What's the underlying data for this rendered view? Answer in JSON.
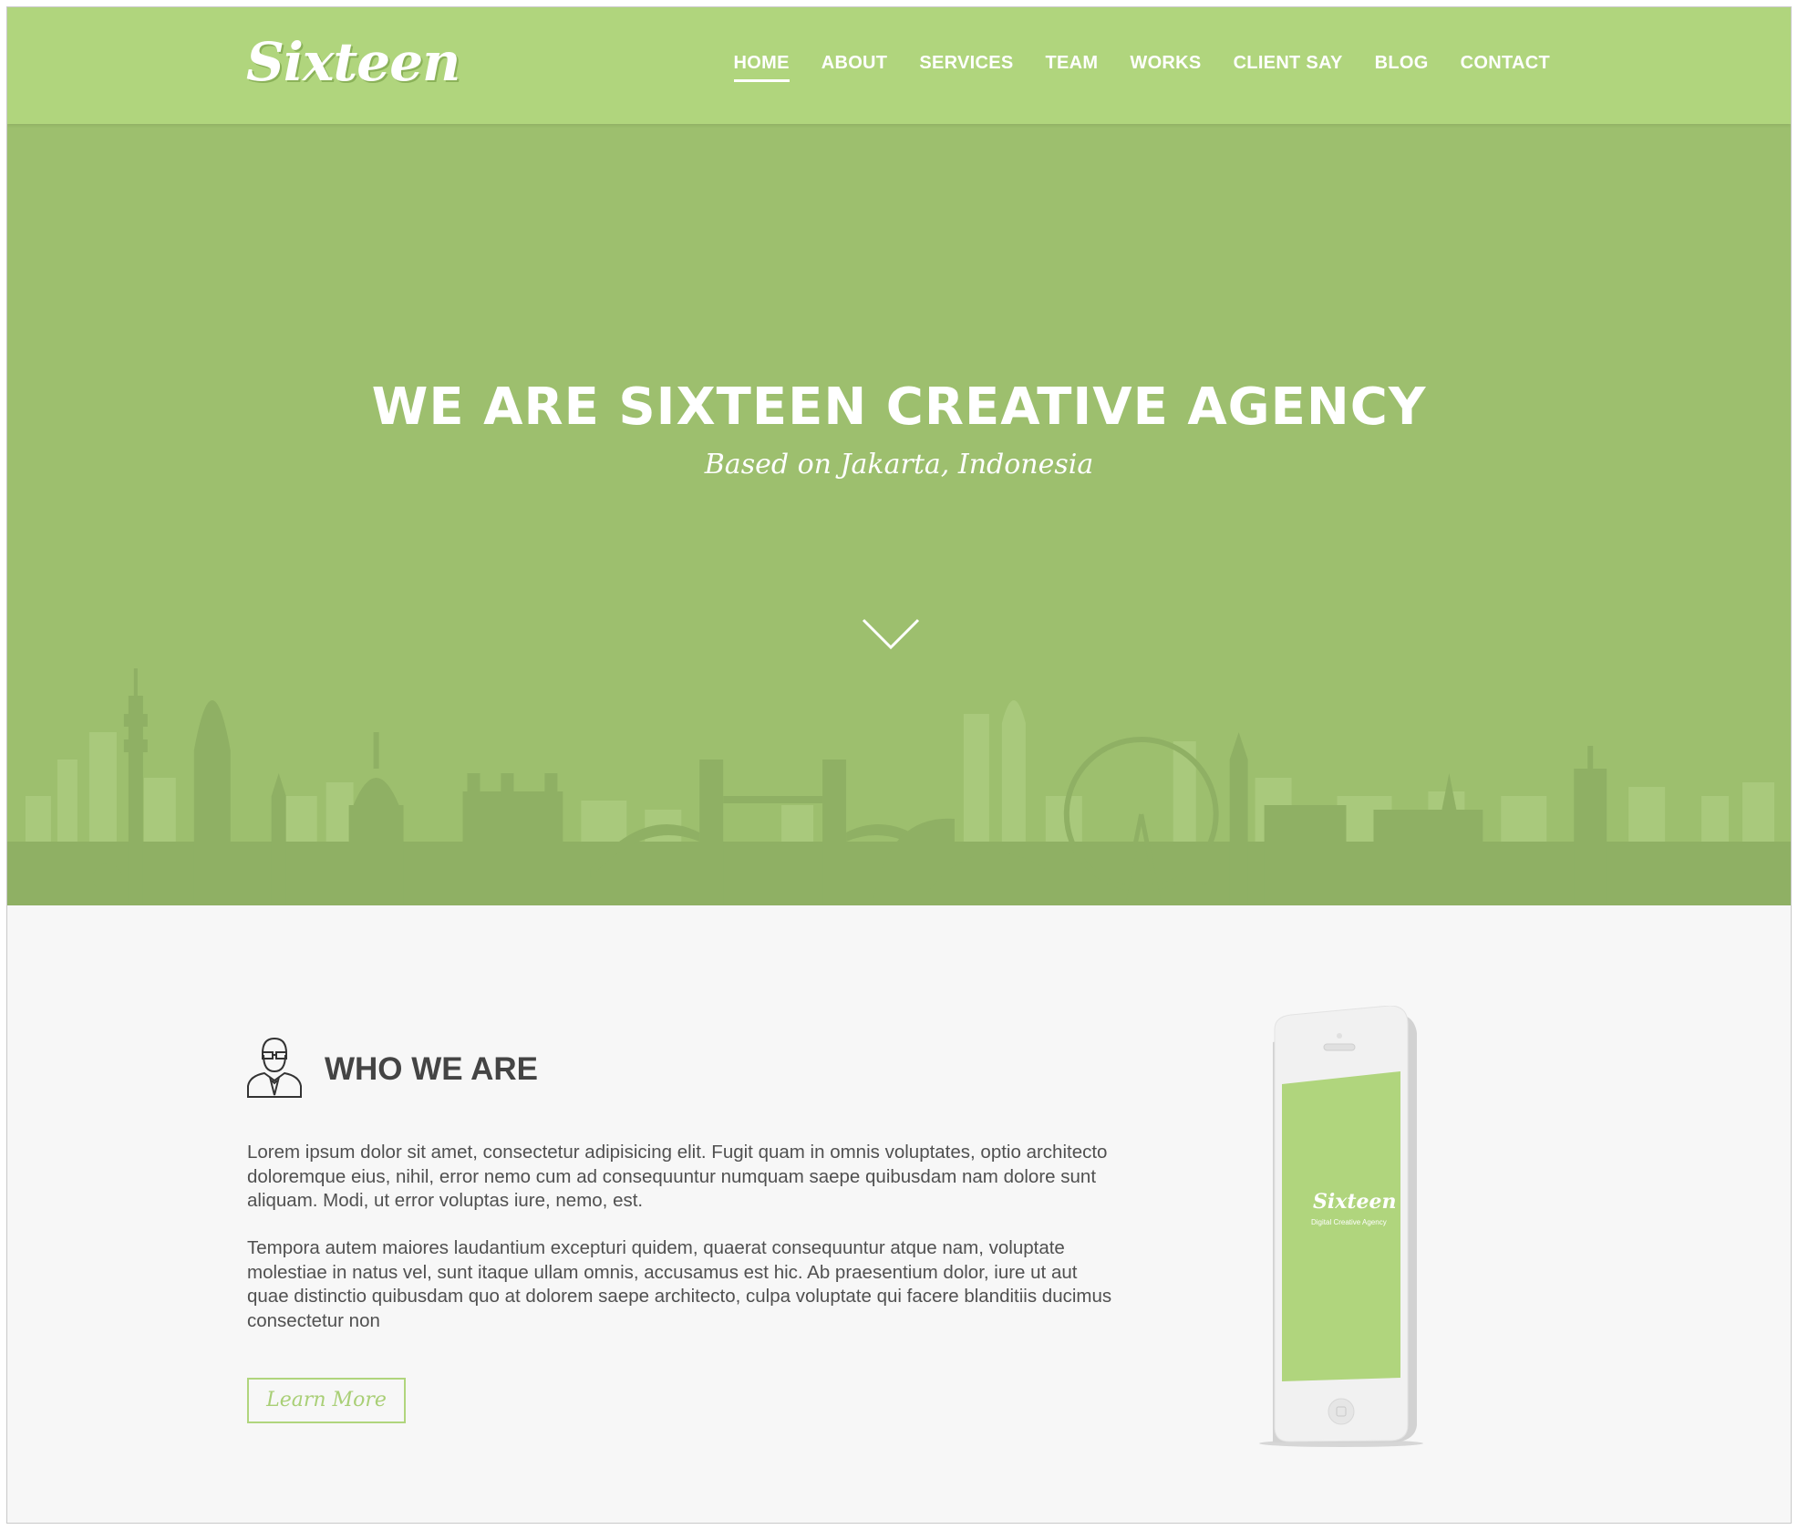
{
  "brand": {
    "logo_text": "Sixteen"
  },
  "nav": {
    "items": [
      {
        "label": "HOME",
        "active": true
      },
      {
        "label": "ABOUT",
        "active": false
      },
      {
        "label": "SERVICES",
        "active": false
      },
      {
        "label": "TEAM",
        "active": false
      },
      {
        "label": "WORKS",
        "active": false
      },
      {
        "label": "CLIENT SAY",
        "active": false
      },
      {
        "label": "BLOG",
        "active": false
      },
      {
        "label": "CONTACT",
        "active": false
      }
    ]
  },
  "hero": {
    "title": "WE ARE SIXTEEN CREATIVE AGENCY",
    "subtitle": "Based on Jakarta, Indonesia",
    "scroll_icon": "chevron-down-icon"
  },
  "about": {
    "icon": "businessman-icon",
    "heading": "WHO WE ARE",
    "paragraphs": [
      "Lorem ipsum dolor sit amet, consectetur adipisicing elit. Fugit quam in omnis voluptates, optio architecto doloremque eius, nihil, error nemo cum ad consequuntur numquam saepe quibusdam nam dolore sunt aliquam. Modi, ut error voluptas iure, nemo, est.",
      "Tempora autem maiores laudantium excepturi quidem, quaerat consequuntur atque nam, voluptate molestiae in natus vel, sunt itaque ullam omnis, accusamus est hic. Ab praesentium dolor, iure ut aut quae distinctio quibusdam quo at dolorem saepe architecto, culpa voluptate qui facere blanditiis ducimus consectetur non"
    ],
    "button_label": "Learn More",
    "phone_screen_logo": "Sixteen",
    "phone_screen_tagline": "Digital Creative Agency"
  },
  "colors": {
    "header_bg": "#b0d57d",
    "hero_bg": "#9dbf6e",
    "skyline_far": "#a9c97c",
    "skyline_near": "#8fb064",
    "page_bg": "#f7f7f7",
    "accent": "#b0d57d",
    "heading_text": "#444444",
    "body_text": "#505050"
  }
}
